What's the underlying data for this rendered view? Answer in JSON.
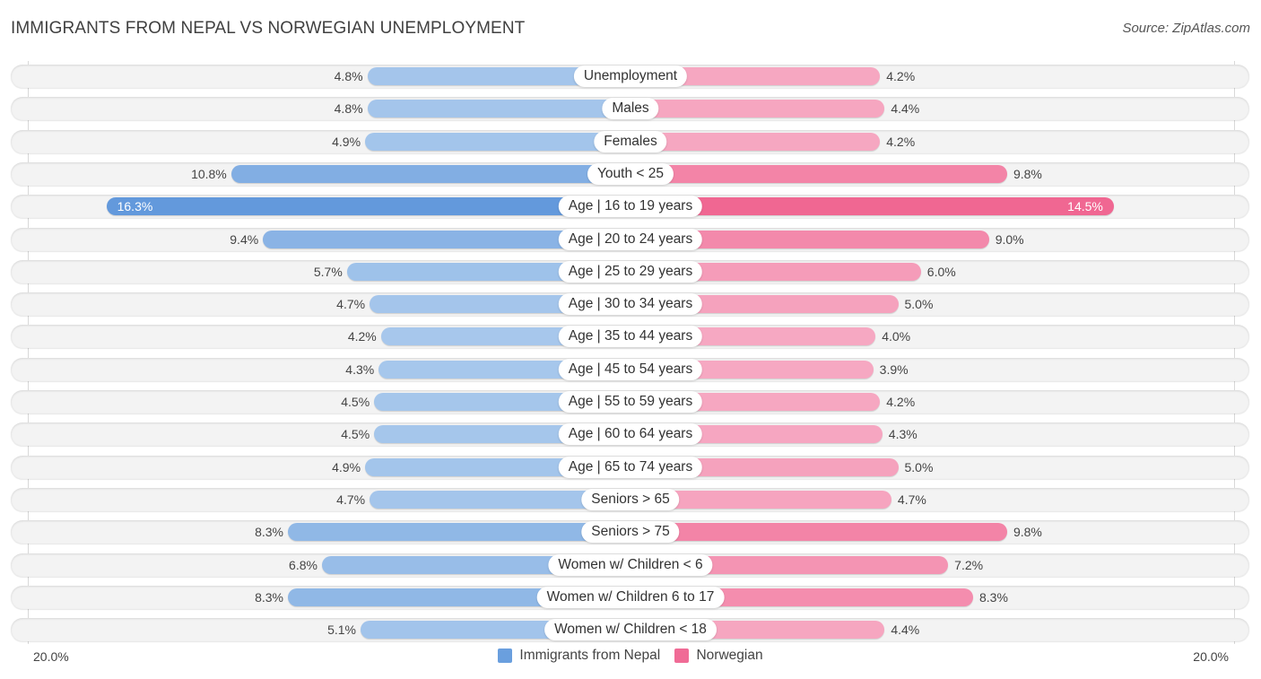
{
  "header": {
    "title": "IMMIGRANTS FROM NEPAL VS NORWEGIAN UNEMPLOYMENT",
    "source": "Source: ZipAtlas.com"
  },
  "colors": {
    "nepal_light": "#a8c8ec",
    "nepal_strong": "#6399dc",
    "norwegian_light": "#f6a8c2",
    "norwegian_strong": "#f06792",
    "legend_nepal": "#6a9fde",
    "legend_norwegian": "#f06b96"
  },
  "axis": {
    "left_label": "20.0%",
    "right_label": "20.0%"
  },
  "legend": {
    "series_a": "Immigrants from Nepal",
    "series_b": "Norwegian"
  },
  "chart_data": {
    "type": "bar",
    "orientation": "diverging-horizontal",
    "title": "IMMIGRANTS FROM NEPAL VS NORWEGIAN UNEMPLOYMENT",
    "xlabel": "",
    "ylabel": "",
    "xlim": [
      -20.0,
      20.0
    ],
    "legend_position": "bottom-center",
    "categories": [
      "Unemployment",
      "Males",
      "Females",
      "Youth < 25",
      "Age | 16 to 19 years",
      "Age | 20 to 24 years",
      "Age | 25 to 29 years",
      "Age | 30 to 34 years",
      "Age | 35 to 44 years",
      "Age | 45 to 54 years",
      "Age | 55 to 59 years",
      "Age | 60 to 64 years",
      "Age | 65 to 74 years",
      "Seniors > 65",
      "Seniors > 75",
      "Women w/ Children < 6",
      "Women w/ Children 6 to 17",
      "Women w/ Children < 18"
    ],
    "series": [
      {
        "name": "Immigrants from Nepal",
        "side": "left",
        "values": [
          4.8,
          4.8,
          4.9,
          10.8,
          16.3,
          9.4,
          5.7,
          4.7,
          4.2,
          4.3,
          4.5,
          4.5,
          4.9,
          4.7,
          8.3,
          6.8,
          8.3,
          5.1
        ],
        "labels": [
          "4.8%",
          "4.8%",
          "4.9%",
          "10.8%",
          "16.3%",
          "9.4%",
          "5.7%",
          "4.7%",
          "4.2%",
          "4.3%",
          "4.5%",
          "4.5%",
          "4.9%",
          "4.7%",
          "8.3%",
          "6.8%",
          "8.3%",
          "5.1%"
        ]
      },
      {
        "name": "Norwegian",
        "side": "right",
        "values": [
          4.2,
          4.4,
          4.2,
          9.8,
          14.5,
          9.0,
          6.0,
          5.0,
          4.0,
          3.9,
          4.2,
          4.3,
          5.0,
          4.7,
          9.8,
          7.2,
          8.3,
          4.4
        ],
        "labels": [
          "4.2%",
          "4.4%",
          "4.2%",
          "9.8%",
          "14.5%",
          "9.0%",
          "6.0%",
          "5.0%",
          "4.0%",
          "3.9%",
          "4.2%",
          "4.3%",
          "5.0%",
          "4.7%",
          "9.8%",
          "7.2%",
          "8.3%",
          "4.4%"
        ]
      }
    ]
  }
}
